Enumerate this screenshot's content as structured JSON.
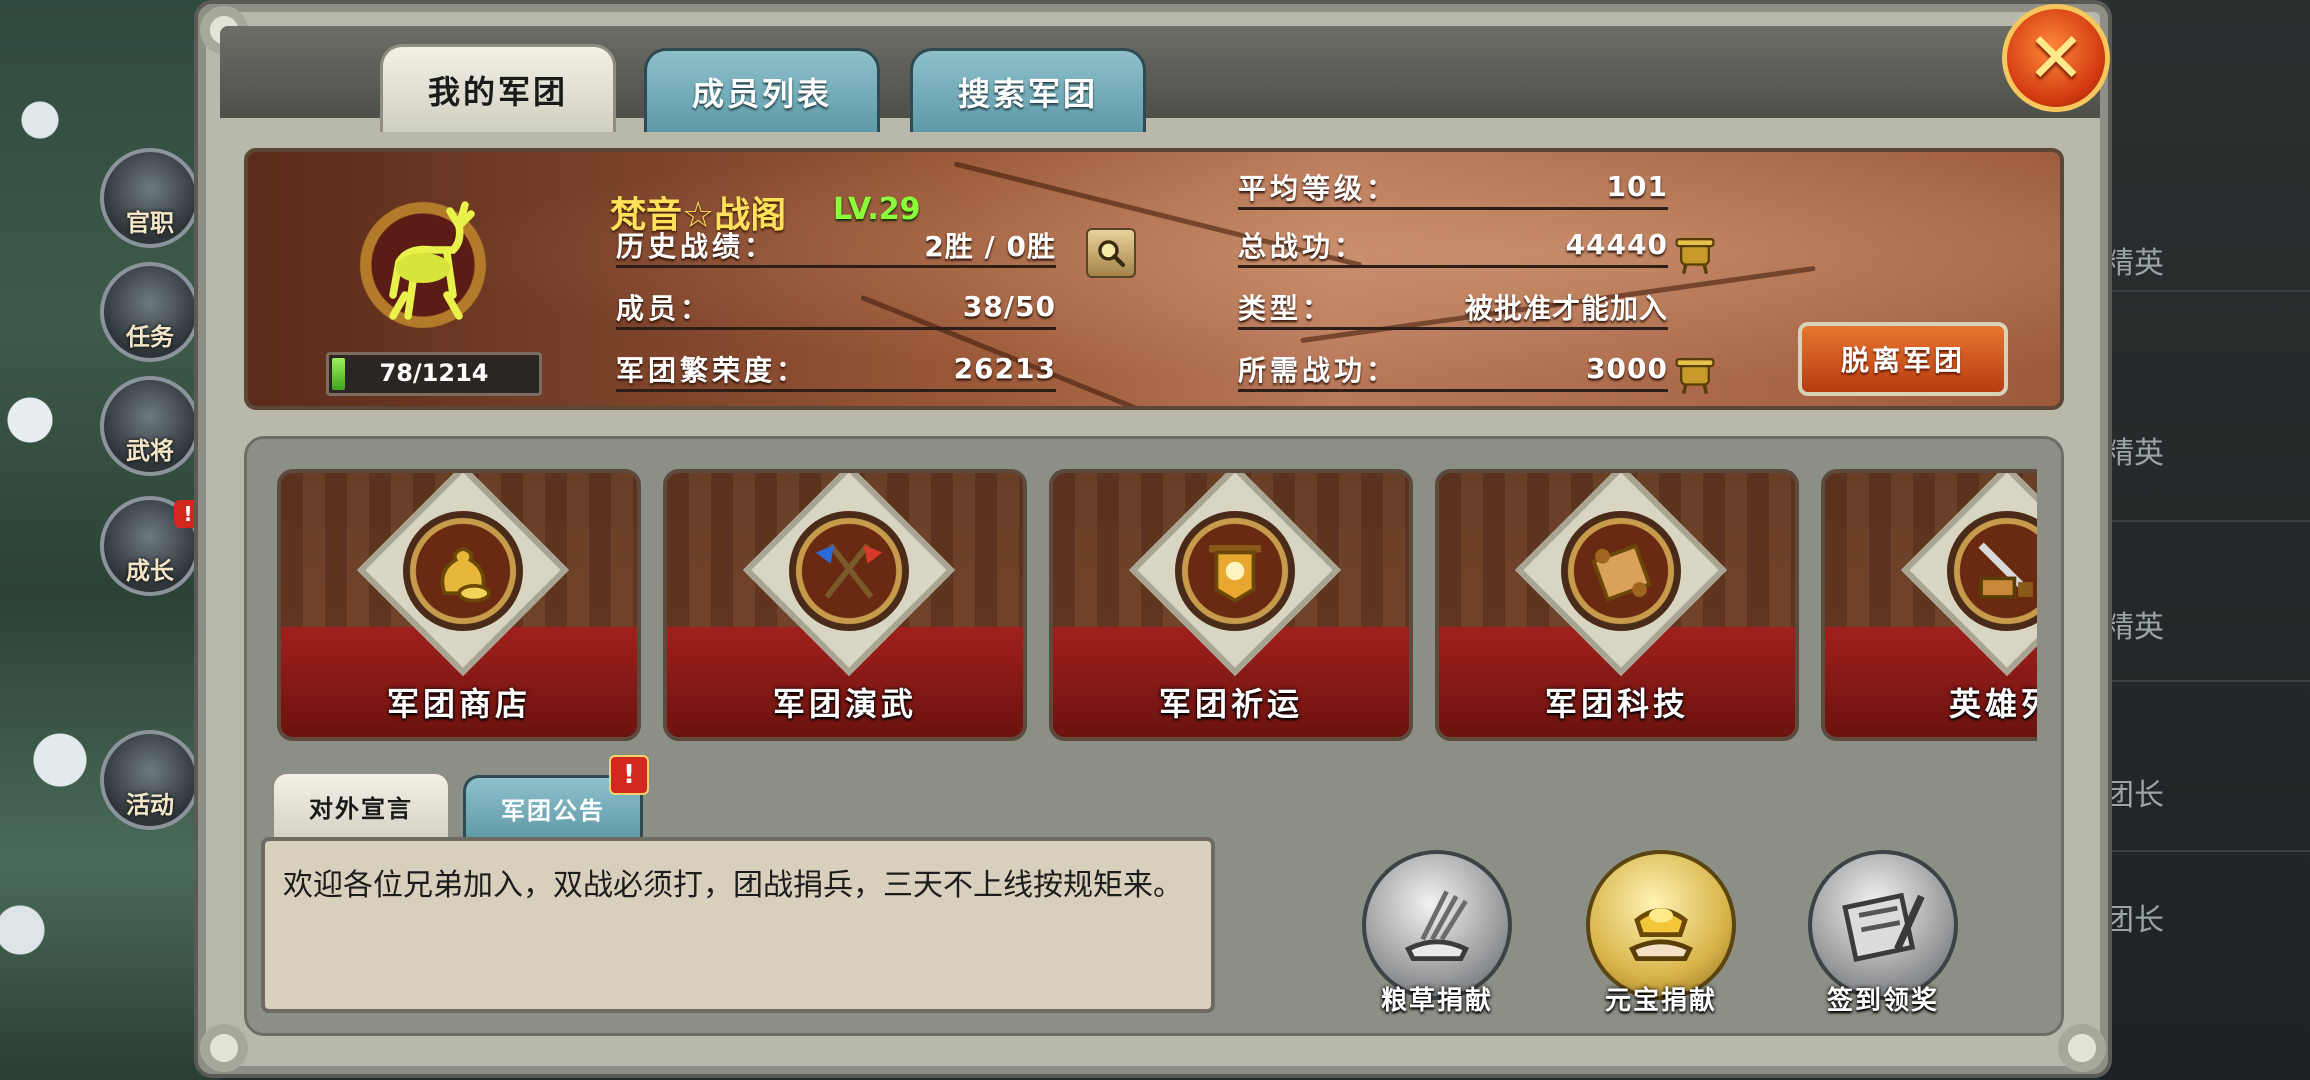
{
  "tabs": [
    {
      "label": "我的军团",
      "active": true
    },
    {
      "label": "成员列表",
      "active": false
    },
    {
      "label": "搜索军团",
      "active": false
    }
  ],
  "close_icon": "close-x-icon",
  "legion": {
    "name": "梵音☆战阁",
    "level": "LV.29",
    "exp_text": "78/1214",
    "exp_ratio": 0.064,
    "rows_left": [
      {
        "label": "历史战绩：",
        "value": "2胜 / 0胜"
      },
      {
        "label": "成员：",
        "value": "38/50"
      },
      {
        "label": "军团繁荣度：",
        "value": "26213"
      }
    ],
    "rows_right": [
      {
        "label": "平均等级：",
        "value": "101"
      },
      {
        "label": "总战功：",
        "value": "44440"
      },
      {
        "label": "类型：",
        "value": "被批准才能加入"
      },
      {
        "label": "所需战功：",
        "value": "3000"
      }
    ],
    "leave_label": "脱离军团"
  },
  "features": [
    {
      "label": "军团商店",
      "icon": "money-bag-icon"
    },
    {
      "label": "军团演武",
      "icon": "crossed-flags-icon"
    },
    {
      "label": "军团祈运",
      "icon": "banner-icon"
    },
    {
      "label": "军团科技",
      "icon": "scroll-icon"
    },
    {
      "label": "英雄列",
      "icon": "sword-icon"
    }
  ],
  "sub_tabs": [
    {
      "label": "对外宣言",
      "active": true
    },
    {
      "label": "军团公告",
      "active": false,
      "alert": "!"
    }
  ],
  "announcement": "欢迎各位兄弟加入，双战必须打，团战捐兵，三天不上线按规矩来。",
  "actions": [
    {
      "label": "粮草捐献",
      "icon": "grain-donate-icon",
      "style": "silver"
    },
    {
      "label": "元宝捐献",
      "icon": "ingot-donate-icon",
      "style": "gold"
    },
    {
      "label": "签到领奖",
      "icon": "sign-in-reward-icon",
      "style": "silver"
    }
  ],
  "background": {
    "left_buttons": [
      {
        "label": "官职"
      },
      {
        "label": "任务"
      },
      {
        "label": "武将"
      },
      {
        "label": "成长",
        "alert": "!"
      },
      {
        "label": "活动"
      }
    ],
    "right_labels": [
      "精英",
      "精英",
      "精英",
      "团长",
      "团长"
    ]
  },
  "colors": {
    "legion_name": "#ffe15a",
    "level": "#8cff3b",
    "exp_fill": "#3fa51d",
    "tab_active": "#e8e6d8",
    "tab_inactive": "#7fb3bf",
    "leave_button": "#c9501c",
    "close_button": "#e24a16"
  }
}
